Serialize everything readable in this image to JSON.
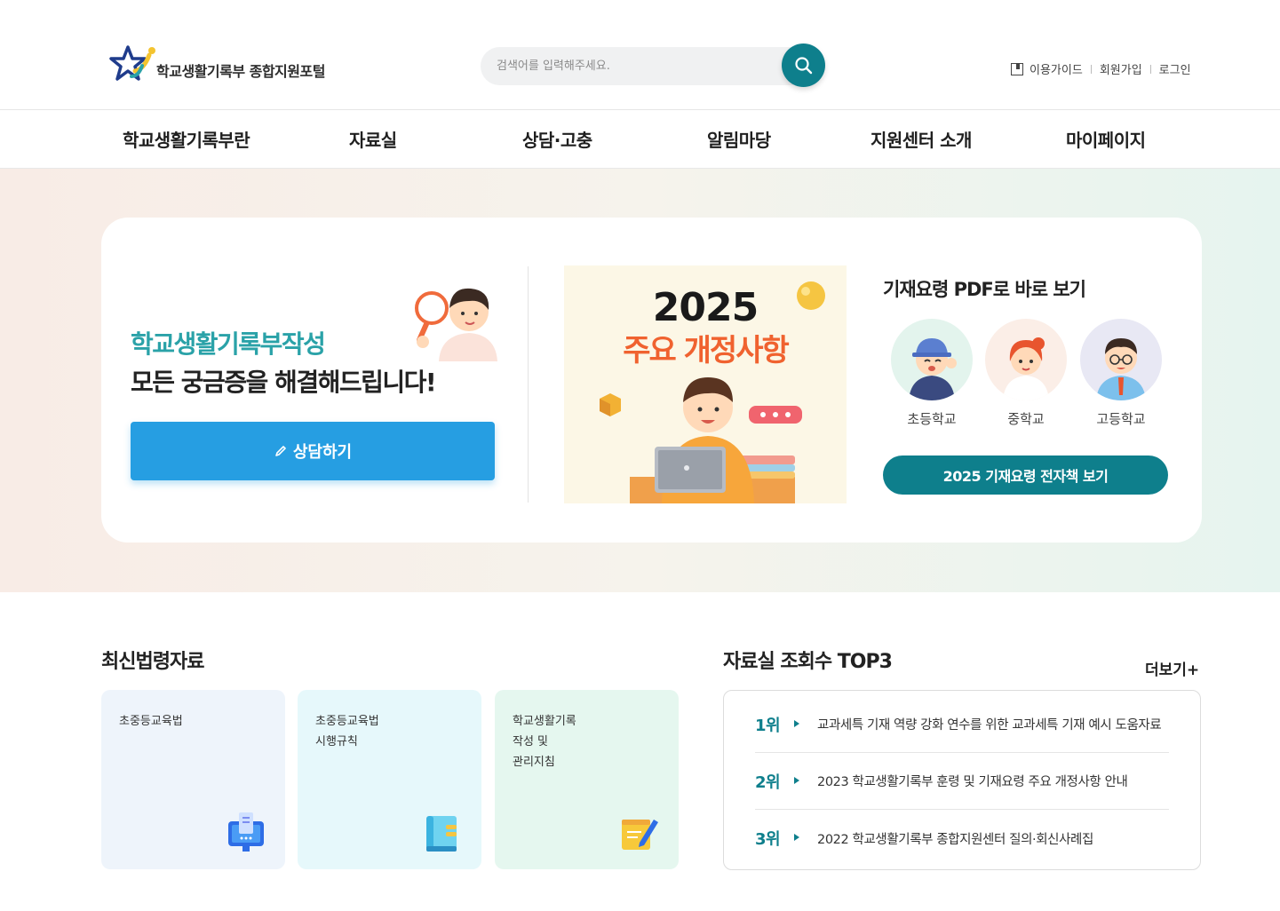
{
  "header": {
    "logo_text": "학교생활기록부 종합지원포털",
    "search_placeholder": "검색어를 입력해주세요.",
    "util": {
      "guide": "이용가이드",
      "signup": "회원가입",
      "login": "로그인"
    }
  },
  "nav": {
    "items": [
      "학교생활기록부란",
      "자료실",
      "상담·고충",
      "알림마당",
      "지원센터 소개",
      "마이페이지"
    ]
  },
  "hero": {
    "subtitle": "학교생활기록부작성",
    "title": "모든 궁금증을 해결해드립니다!",
    "consult_button": "상담하기",
    "banner": {
      "year": "2025",
      "headline": "주요 개정사항"
    },
    "pdf_title": "기재요령 PDF로 바로 보기",
    "levels": [
      "초등학교",
      "중학교",
      "고등학교"
    ],
    "ebook_button": "2025 기재요령 전자책 보기"
  },
  "laws": {
    "title": "최신법령자료",
    "cards": [
      {
        "label": "초중등교육법",
        "icon": "monitor-doc-icon",
        "color": "#eef4fb"
      },
      {
        "label": "초중등교육법\n시행규칙",
        "icon": "book-icon",
        "color": "#e6f8fb"
      },
      {
        "label": "학교생활기록\n작성 및\n관리지침",
        "icon": "notepad-pen-icon",
        "color": "#e5f7ef"
      }
    ]
  },
  "top3": {
    "title": "자료실 조회수 TOP3",
    "more": "더보기+",
    "items": [
      {
        "rank": "1위",
        "text": "교과세특 기재 역량 강화 연수를 위한 교과세특 기재 예시 도움자료"
      },
      {
        "rank": "2위",
        "text": "2023 학교생활기록부 훈령 및 기재요령 주요 개정사항 안내"
      },
      {
        "rank": "3위",
        "text": "2022 학교생활기록부 종합지원센터 질의·회신사례집"
      }
    ]
  },
  "colors": {
    "primary_teal": "#0e7f8c",
    "accent_teal": "#2aa2a8",
    "consult_blue": "#269ee2",
    "banner_orange": "#f0622f"
  }
}
